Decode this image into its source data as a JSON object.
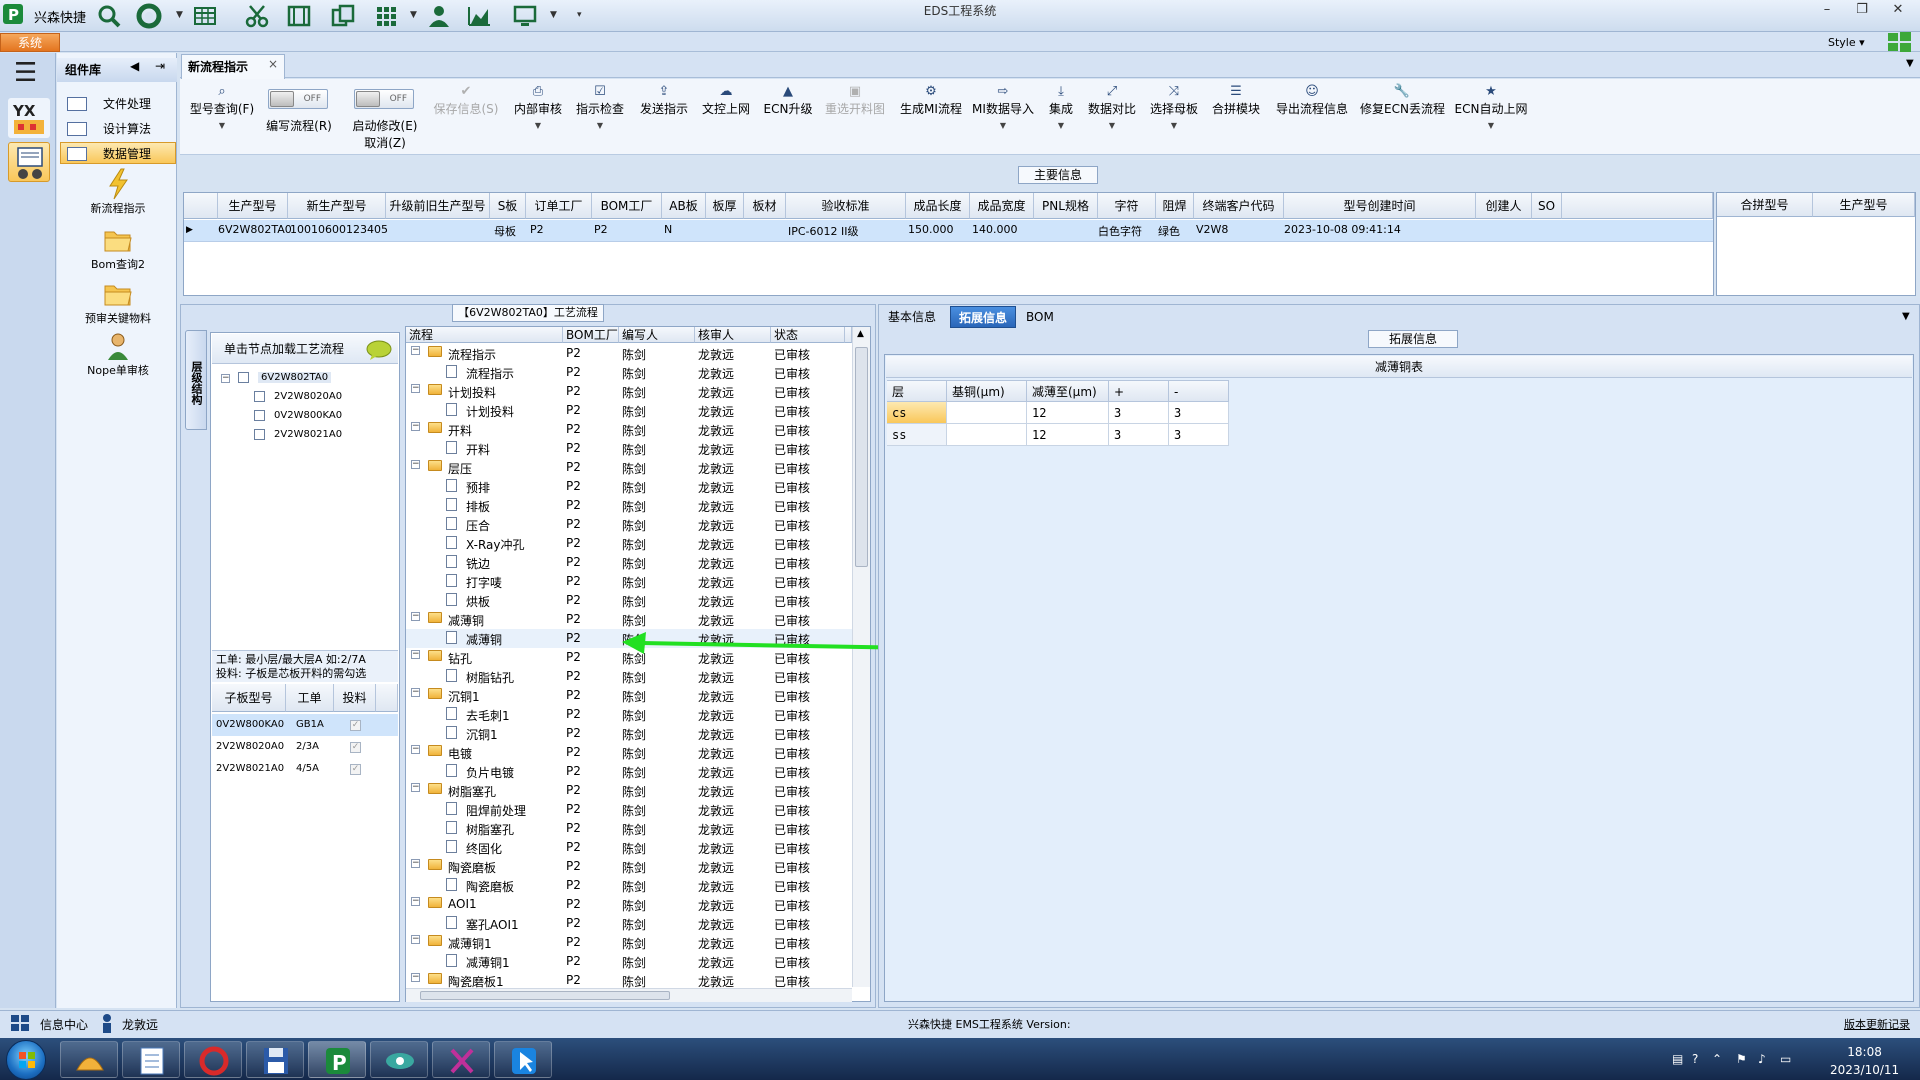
{
  "titlebar": {
    "quick_title": "兴森快捷",
    "window_title": "EDS工程系统"
  },
  "ribbon": {
    "tab_system": "系统",
    "style_menu": "Style ▾"
  },
  "library": {
    "title": "组件库",
    "items": [
      "文件处理",
      "设计算法",
      "数据管理"
    ],
    "tools": [
      "新流程指示",
      "Bom查询2",
      "预审关键物料",
      "Nope单审核"
    ]
  },
  "doc_tab": {
    "label": "新流程指示",
    "close": "×"
  },
  "toolbar": {
    "query_model": "型号查询(F)",
    "write_flow": "编写流程(R)",
    "start_modify": "启动修改(E)",
    "cancel": "取消(Z)",
    "toggle_off": "OFF",
    "save_info": "保存信息(S)",
    "internal_review": "内部审核",
    "check_instruction": "指示检查",
    "send_instruction": "发送指示",
    "file_upload": "文控上网",
    "ecn_upgrade": "ECN升级",
    "reselect_drawing": "重选开料图",
    "generate_mi": "生成MI流程",
    "mi_import": "MI数据导入",
    "integrate": "集成",
    "data_compare": "数据对比",
    "select_mother": "选择母板",
    "merge_module": "合拼模块",
    "export_flow": "导出流程信息",
    "fix_ecn": "修复ECN丢流程",
    "ecn_auto": "ECN自动上网"
  },
  "main_info": {
    "caption": "主要信息",
    "columns": [
      "生产型号",
      "新生产型号",
      "升级前旧生产型号",
      "S板",
      "订单工厂",
      "BOM工厂",
      "AB板",
      "板厚",
      "板材",
      "验收标准",
      "成品长度",
      "成品宽度",
      "PNL规格",
      "字符",
      "阻焊",
      "终端客户代码",
      "型号创建时间",
      "创建人",
      "SO"
    ],
    "row": {
      "model": "6V2W802TA0",
      "new_model": "10010600123405",
      "old_model": "",
      "s_board": "母板",
      "order_factory": "P2",
      "bom_factory": "P2",
      "ab": "N",
      "thickness": "",
      "material": "",
      "standard": "IPC-6012 II级",
      "length": "150.000",
      "width": "140.000",
      "pnl": "",
      "char": "白色字符",
      "mask": "绿色",
      "customer": "V2W8",
      "created": "2023-10-08 09:41:14",
      "creator": "",
      "so": ""
    },
    "merge_columns": [
      "合拼型号",
      "生产型号"
    ]
  },
  "process": {
    "caption": "【6V2W802TA0】工艺流程",
    "side_tab": "层级结构",
    "load_header": "单击节点加载工艺流程",
    "tree_root": "6V2W802TA0",
    "tree_children": [
      "2V2W8020A0",
      "0V2W800KA0",
      "2V2W8021A0"
    ],
    "note_line1": "工单: 最小层/最大层A 如:2/7A",
    "note_line2": "投料: 子板是芯板开料的需勾选",
    "sub_columns": [
      "子板型号",
      "工单",
      "投料"
    ],
    "sub_rows": [
      {
        "model": "0V2W800KA0",
        "order": "GB1A",
        "check": "✓"
      },
      {
        "model": "2V2W8020A0",
        "order": "2/3A",
        "check": "✓"
      },
      {
        "model": "2V2W8021A0",
        "order": "4/5A",
        "check": "✓"
      }
    ],
    "grid_columns": [
      "流程",
      "BOM工厂",
      "编写人",
      "核审人",
      "状态"
    ],
    "rows": [
      {
        "name": "流程指示",
        "type": "folder",
        "factory": "P2",
        "writer": "陈剑",
        "reviewer": "龙敦远",
        "status": "已审核"
      },
      {
        "name": "流程指示",
        "type": "doc",
        "factory": "P2",
        "writer": "陈剑",
        "reviewer": "龙敦远",
        "status": "已审核"
      },
      {
        "name": "计划投料",
        "type": "folder",
        "factory": "P2",
        "writer": "陈剑",
        "reviewer": "龙敦远",
        "status": "已审核"
      },
      {
        "name": "计划投料",
        "type": "doc",
        "factory": "P2",
        "writer": "陈剑",
        "reviewer": "龙敦远",
        "status": "已审核"
      },
      {
        "name": "开料",
        "type": "folder",
        "factory": "P2",
        "writer": "陈剑",
        "reviewer": "龙敦远",
        "status": "已审核"
      },
      {
        "name": "开料",
        "type": "doc",
        "factory": "P2",
        "writer": "陈剑",
        "reviewer": "龙敦远",
        "status": "已审核"
      },
      {
        "name": "层压",
        "type": "folder",
        "factory": "P2",
        "writer": "陈剑",
        "reviewer": "龙敦远",
        "status": "已审核"
      },
      {
        "name": "预排",
        "type": "doc",
        "factory": "P2",
        "writer": "陈剑",
        "reviewer": "龙敦远",
        "status": "已审核"
      },
      {
        "name": "排板",
        "type": "doc",
        "factory": "P2",
        "writer": "陈剑",
        "reviewer": "龙敦远",
        "status": "已审核"
      },
      {
        "name": "压合",
        "type": "doc",
        "factory": "P2",
        "writer": "陈剑",
        "reviewer": "龙敦远",
        "status": "已审核"
      },
      {
        "name": "X-Ray冲孔",
        "type": "doc",
        "factory": "P2",
        "writer": "陈剑",
        "reviewer": "龙敦远",
        "status": "已审核"
      },
      {
        "name": "铣边",
        "type": "doc",
        "factory": "P2",
        "writer": "陈剑",
        "reviewer": "龙敦远",
        "status": "已审核"
      },
      {
        "name": "打字唛",
        "type": "doc",
        "factory": "P2",
        "writer": "陈剑",
        "reviewer": "龙敦远",
        "status": "已审核"
      },
      {
        "name": "烘板",
        "type": "doc",
        "factory": "P2",
        "writer": "陈剑",
        "reviewer": "龙敦远",
        "status": "已审核"
      },
      {
        "name": "减薄铜",
        "type": "folder",
        "factory": "P2",
        "writer": "陈剑",
        "reviewer": "龙敦远",
        "status": "已审核"
      },
      {
        "name": "减薄铜",
        "type": "doc",
        "factory": "P2",
        "writer": "陈剑",
        "reviewer": "龙敦远",
        "status": "已审核"
      },
      {
        "name": "钻孔",
        "type": "folder",
        "factory": "P2",
        "writer": "陈剑",
        "reviewer": "龙敦远",
        "status": "已审核"
      },
      {
        "name": "树脂钻孔",
        "type": "doc",
        "factory": "P2",
        "writer": "陈剑",
        "reviewer": "龙敦远",
        "status": "已审核"
      },
      {
        "name": "沉铜1",
        "type": "folder",
        "factory": "P2",
        "writer": "陈剑",
        "reviewer": "龙敦远",
        "status": "已审核"
      },
      {
        "name": "去毛刺1",
        "type": "doc",
        "factory": "P2",
        "writer": "陈剑",
        "reviewer": "龙敦远",
        "status": "已审核"
      },
      {
        "name": "沉铜1",
        "type": "doc",
        "factory": "P2",
        "writer": "陈剑",
        "reviewer": "龙敦远",
        "status": "已审核"
      },
      {
        "name": "电镀",
        "type": "folder",
        "factory": "P2",
        "writer": "陈剑",
        "reviewer": "龙敦远",
        "status": "已审核"
      },
      {
        "name": "负片电镀",
        "type": "doc",
        "factory": "P2",
        "writer": "陈剑",
        "reviewer": "龙敦远",
        "status": "已审核"
      },
      {
        "name": "树脂塞孔",
        "type": "folder",
        "factory": "P2",
        "writer": "陈剑",
        "reviewer": "龙敦远",
        "status": "已审核"
      },
      {
        "name": "阻焊前处理",
        "type": "doc",
        "factory": "P2",
        "writer": "陈剑",
        "reviewer": "龙敦远",
        "status": "已审核"
      },
      {
        "name": "树脂塞孔",
        "type": "doc",
        "factory": "P2",
        "writer": "陈剑",
        "reviewer": "龙敦远",
        "status": "已审核"
      },
      {
        "name": "终固化",
        "type": "doc",
        "factory": "P2",
        "writer": "陈剑",
        "reviewer": "龙敦远",
        "status": "已审核"
      },
      {
        "name": "陶瓷磨板",
        "type": "folder",
        "factory": "P2",
        "writer": "陈剑",
        "reviewer": "龙敦远",
        "status": "已审核"
      },
      {
        "name": "陶瓷磨板",
        "type": "doc",
        "factory": "P2",
        "writer": "陈剑",
        "reviewer": "龙敦远",
        "status": "已审核"
      },
      {
        "name": "AOI1",
        "type": "folder",
        "factory": "P2",
        "writer": "陈剑",
        "reviewer": "龙敦远",
        "status": "已审核"
      },
      {
        "name": "塞孔AOI1",
        "type": "doc",
        "factory": "P2",
        "writer": "陈剑",
        "reviewer": "龙敦远",
        "status": "已审核"
      },
      {
        "name": "减薄铜1",
        "type": "folder",
        "factory": "P2",
        "writer": "陈剑",
        "reviewer": "龙敦远",
        "status": "已审核"
      },
      {
        "name": "减薄铜1",
        "type": "doc",
        "factory": "P2",
        "writer": "陈剑",
        "reviewer": "龙敦远",
        "status": "已审核"
      },
      {
        "name": "陶瓷磨板1",
        "type": "folder",
        "factory": "P2",
        "writer": "陈剑",
        "reviewer": "龙敦远",
        "status": "已审核"
      }
    ]
  },
  "right": {
    "tabs": [
      "基本信息",
      "拓展信息",
      "BOM"
    ],
    "ext_caption": "拓展信息",
    "table_title": "减薄铜表",
    "columns": [
      "层",
      "基铜(μm)",
      "减薄至(μm)",
      "+",
      "-"
    ],
    "rows": [
      {
        "layer": "cs",
        "base": "",
        "target": "12",
        "plus": "3",
        "minus": "3"
      },
      {
        "layer": "ss",
        "base": "",
        "target": "12",
        "plus": "3",
        "minus": "3"
      }
    ]
  },
  "status": {
    "info_center": "信息中心",
    "user": "龙敦远",
    "center_text": "兴森快捷 EMS工程系统 Version:",
    "version_log": "版本更新记录"
  },
  "taskbar": {
    "time": "18:08",
    "date": "2023/10/11"
  },
  "colors": {
    "highlight_arrow": "#22e022",
    "selected_orange": "#f9c75a",
    "active_tab": "#2a66b8"
  }
}
